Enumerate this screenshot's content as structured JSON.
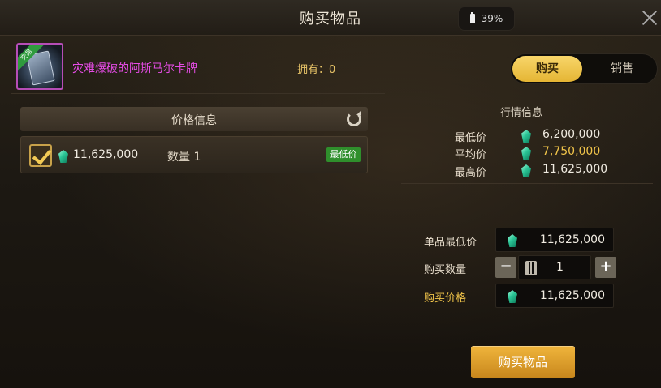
{
  "header": {
    "title": "购买物品",
    "battery": "39%"
  },
  "item": {
    "badge": "交易",
    "name": "灾难爆破的阿斯马尔卡牌",
    "owned": "拥有：0"
  },
  "mode_tabs": {
    "buy": "购买",
    "sell": "销售"
  },
  "price_info": {
    "header": "价格信息",
    "listing": {
      "price": "11,625,000",
      "quantity": "数量 1",
      "badge": "最低价"
    }
  },
  "market": {
    "title": "行情信息",
    "lowest_label": "最低价",
    "lowest_value": "6,200,000",
    "average_label": "平均价",
    "average_value": "7,750,000",
    "highest_label": "最高价",
    "highest_value": "11,625,000"
  },
  "purchase": {
    "unit_lowest_label": "单品最低价",
    "unit_lowest_value": "11,625,000",
    "quantity_label": "购买数量",
    "quantity_value": "1",
    "minus": "−",
    "plus": "+",
    "total_label": "购买价格",
    "total_value": "11,625,000",
    "submit": "购买物品"
  },
  "colors": {
    "accent_gold": "#e5b534",
    "item_name": "#e64ce6",
    "average_price": "#f2c54a",
    "lowest_badge": "#2f8f2c"
  }
}
